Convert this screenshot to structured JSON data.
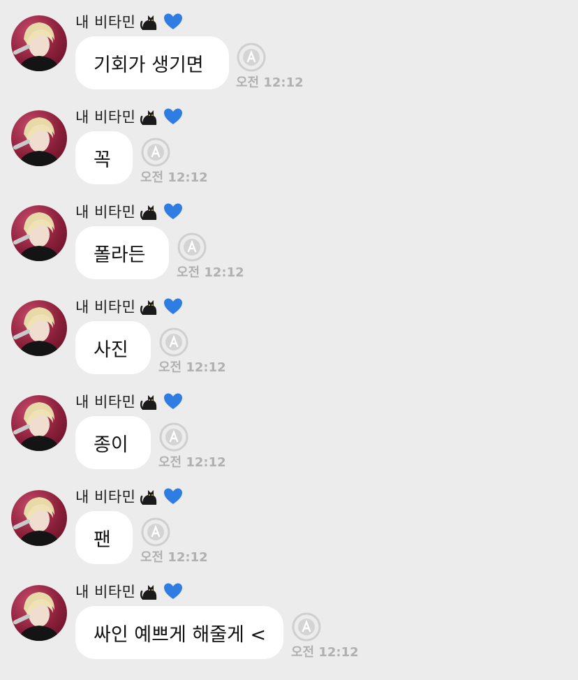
{
  "theme": {
    "background": "#ececec",
    "bubble": "#ffffff",
    "timestamp": "#b0b0b0",
    "heart": "#2f7de1"
  },
  "sender": {
    "name": "내 비타민",
    "icons": [
      "black-cat-icon",
      "blue-heart-icon"
    ]
  },
  "messages": [
    {
      "text": "기회가 생기면",
      "time": "오전 12:12"
    },
    {
      "text": "꼭",
      "time": "오전 12:12"
    },
    {
      "text": "폴라든",
      "time": "오전 12:12"
    },
    {
      "text": "사진",
      "time": "오전 12:12"
    },
    {
      "text": "종이",
      "time": "오전 12:12"
    },
    {
      "text": "팬",
      "time": "오전 12:12"
    },
    {
      "text": "싸인 예쁘게 해줄게 <",
      "time": "오전 12:12"
    }
  ]
}
